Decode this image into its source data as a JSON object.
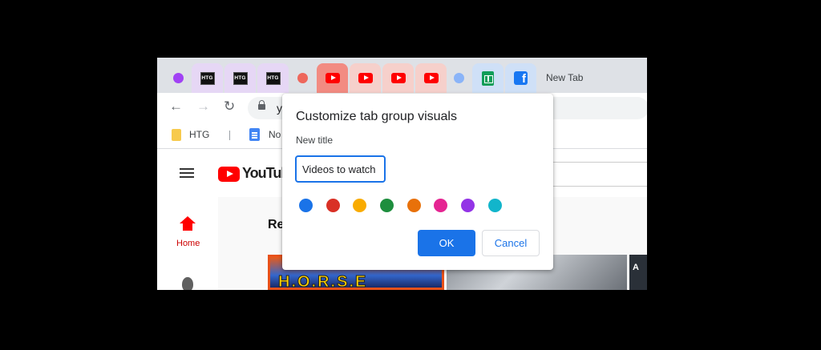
{
  "browser": {
    "tab_groups": [
      {
        "color": "#a142f4",
        "tabs": [
          "htg",
          "htg",
          "htg"
        ],
        "tab_bg": "#e6d7f5"
      },
      {
        "color": "#ee675c",
        "tabs": [
          "youtube",
          "youtube",
          "youtube",
          "youtube"
        ],
        "tab_bg": "#f6d0cb",
        "active_bg": "#f28b82"
      },
      {
        "color": "#8ab4f8",
        "tabs": [
          "sheets",
          "facebook"
        ],
        "tab_bg": "#cfe0f7"
      }
    ],
    "htg_icon_text": "HTG",
    "new_tab_label": "New Tab",
    "url_partial": "y",
    "bookmarks": {
      "item1": "HTG",
      "item2_partial": "No"
    }
  },
  "youtube": {
    "logo_text": "YouTube",
    "home_label": "Home",
    "section_title_partial": "Re",
    "thumb1_text": "H.O.R.S.E",
    "thumb3_text": "A"
  },
  "dialog": {
    "title": "Customize tab group visuals",
    "subtitle": "New title",
    "input_value": "Videos to watch",
    "colors": [
      "#1a73e8",
      "#d93025",
      "#f9ab00",
      "#1e8e3e",
      "#e8710a",
      "#e52592",
      "#9334e6",
      "#12b5cb"
    ],
    "ok_label": "OK",
    "cancel_label": "Cancel"
  }
}
